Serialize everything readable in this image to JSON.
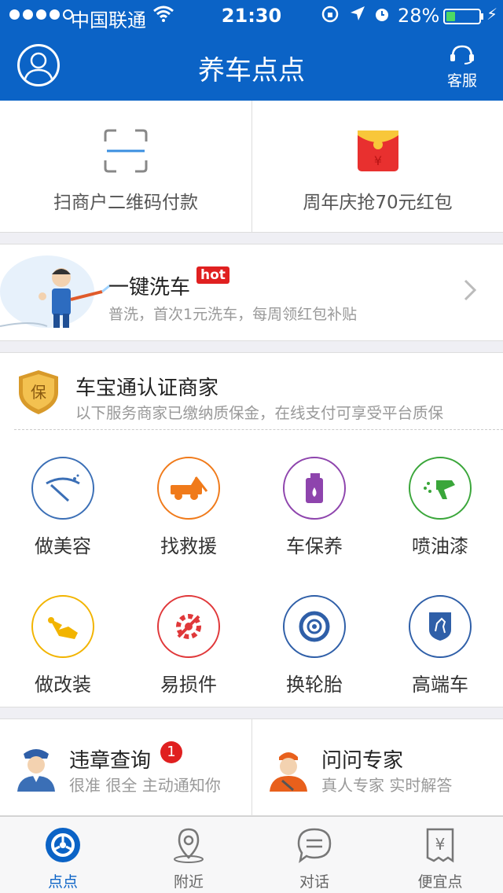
{
  "status_bar": {
    "carrier": "中国联通",
    "time": "21:30",
    "battery_percent": "28%",
    "battery_level": 0.28,
    "icons": [
      "signal-dots-icon",
      "wifi-icon",
      "rotation-lock-icon",
      "location-arrow-icon",
      "alarm-icon",
      "battery-icon",
      "charging-bolt-icon"
    ]
  },
  "header": {
    "title": "养车点点",
    "service_label": "客服",
    "avatar_icon": "user-avatar-icon",
    "service_icon": "headset-icon",
    "color": "#0b63c6"
  },
  "quick_actions": [
    {
      "label": "扫商户二维码付款",
      "icon": "qr-scan-icon"
    },
    {
      "label": "周年庆抢70元红包",
      "icon": "red-envelope-icon"
    }
  ],
  "car_wash": {
    "title": "一键洗车",
    "badge": "hot",
    "subtitle": "普洗，首次1元洗车，每周领红包补贴",
    "icon": "car-wash-man-illustration"
  },
  "merchant": {
    "badge_char": "保",
    "title": "车宝通认证商家",
    "subtitle": "以下服务商家已缴纳质保金，在线支付可享受平台质保"
  },
  "services": [
    {
      "label": "做美容",
      "icon": "wiper-icon",
      "color": "#3b6fb6"
    },
    {
      "label": "找救援",
      "icon": "tow-truck-icon",
      "color": "#f07a1a"
    },
    {
      "label": "车保养",
      "icon": "oil-can-icon",
      "color": "#8e44ad"
    },
    {
      "label": "喷油漆",
      "icon": "spray-gun-icon",
      "color": "#3aa63a"
    },
    {
      "label": "做改装",
      "icon": "modify-icon",
      "color": "#f2b400"
    },
    {
      "label": "易损件",
      "icon": "gear-wrench-icon",
      "color": "#e0383a"
    },
    {
      "label": "换轮胎",
      "icon": "tire-icon",
      "color": "#2f5fa8"
    },
    {
      "label": "高端车",
      "icon": "horse-shield-icon",
      "color": "#2f5fa8"
    }
  ],
  "extras": [
    {
      "title": "违章查询",
      "subtitle": "很准 很全 主动通知你",
      "badge": "1",
      "icon": "police-officer-icon"
    },
    {
      "title": "问问专家",
      "subtitle": "真人专家 实时解答",
      "icon": "mechanic-expert-icon"
    }
  ],
  "tabs": [
    {
      "label": "点点",
      "icon": "wheel-tab-icon",
      "active": true
    },
    {
      "label": "附近",
      "icon": "map-pin-icon",
      "active": false
    },
    {
      "label": "对话",
      "icon": "chat-bubble-icon",
      "active": false
    },
    {
      "label": "便宜点",
      "icon": "yuan-receipt-icon",
      "active": false
    }
  ]
}
